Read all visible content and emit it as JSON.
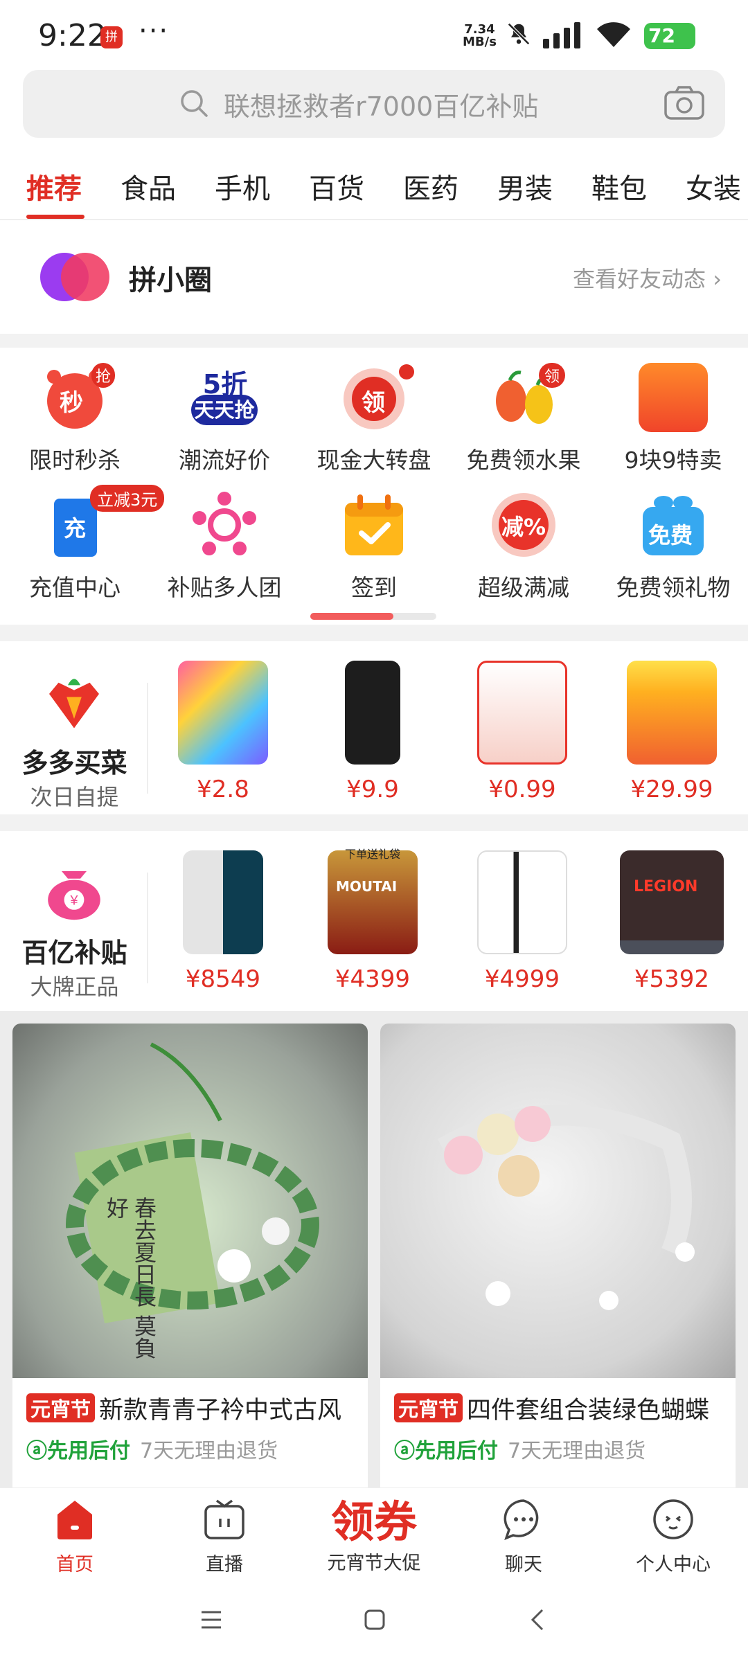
{
  "status_bar": {
    "time": "9:22",
    "app_icon_text": "拼",
    "dots": "···",
    "speed_value": "7.34",
    "speed_unit": "MB/s",
    "battery": "72"
  },
  "search": {
    "placeholder": "联想拯救者r7000百亿补贴"
  },
  "tabs": [
    "推荐",
    "食品",
    "手机",
    "百货",
    "医药",
    "男装",
    "鞋包",
    "女装"
  ],
  "circle": {
    "title": "拼小圈",
    "link": "查看好友动态 ›"
  },
  "grid": [
    {
      "label": "限时秒杀",
      "icon": "clock-icon",
      "badge": "抢",
      "char": "秒"
    },
    {
      "label": "潮流好价",
      "icon": "discount-icon",
      "top": "5折",
      "bottom": "天天抢"
    },
    {
      "label": "现金大转盘",
      "icon": "wheel-icon",
      "char": "领"
    },
    {
      "label": "免费领水果",
      "icon": "fruit-icon",
      "badge": "领"
    },
    {
      "label": "9块9特卖",
      "icon": "sale-icon"
    },
    {
      "label": "充值中心",
      "icon": "recharge-icon",
      "badge": "立减3元",
      "char": "充"
    },
    {
      "label": "补贴多人团",
      "icon": "group-icon"
    },
    {
      "label": "签到",
      "icon": "checkin-icon"
    },
    {
      "label": "超级满减",
      "icon": "reduce-icon",
      "char": "减%"
    },
    {
      "label": "免费领礼物",
      "icon": "gift-icon",
      "char": "免费"
    }
  ],
  "veg": {
    "name": "多多买菜",
    "sub": "次日自提",
    "prices": [
      "¥2.8",
      "¥9.9",
      "¥0.99",
      "¥29.99"
    ]
  },
  "subsidy": {
    "name": "百亿补贴",
    "sub": "大牌正品",
    "prices": [
      "¥8549",
      "¥4399",
      "¥4999",
      "¥5392"
    ],
    "laptop_text": "LEGION",
    "gift_text": "下单送礼袋",
    "moutai_text": "MOUTAI"
  },
  "cards": [
    {
      "tag": "元宵节",
      "title": "新款青青子衿中式古风",
      "service": "先用后付",
      "refund": "7天无理由退货",
      "note_text": "春去夏日長 莫負好"
    },
    {
      "tag": "元宵节",
      "title": "四件套组合装绿色蝴蝶",
      "service": "先用后付",
      "refund": "7天无理由退货"
    }
  ],
  "nav": [
    {
      "label": "首页",
      "icon": "home-icon"
    },
    {
      "label": "直播",
      "icon": "live-tv-icon"
    },
    {
      "label": "元宵节大促",
      "big": "领券"
    },
    {
      "label": "聊天",
      "icon": "chat-icon"
    },
    {
      "label": "个人中心",
      "icon": "profile-icon"
    }
  ],
  "colors": {
    "accent": "#e02e24",
    "green": "#20a23a",
    "bg_gap": "#f2f2f2"
  }
}
